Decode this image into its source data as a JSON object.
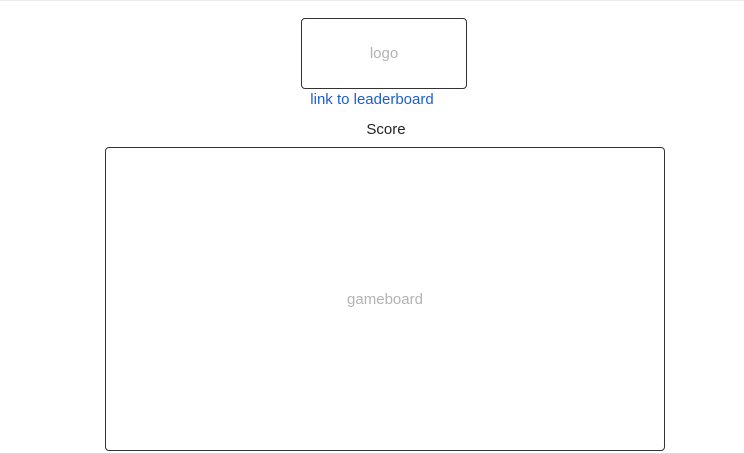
{
  "header": {
    "logo_placeholder": "logo",
    "leaderboard_link": "link to leaderboard"
  },
  "score": {
    "label": "Score"
  },
  "gameboard": {
    "placeholder": "gameboard"
  },
  "colors": {
    "link": "#1a5fd1",
    "placeholder_text": "#b3b3b3",
    "border": "#333333"
  }
}
